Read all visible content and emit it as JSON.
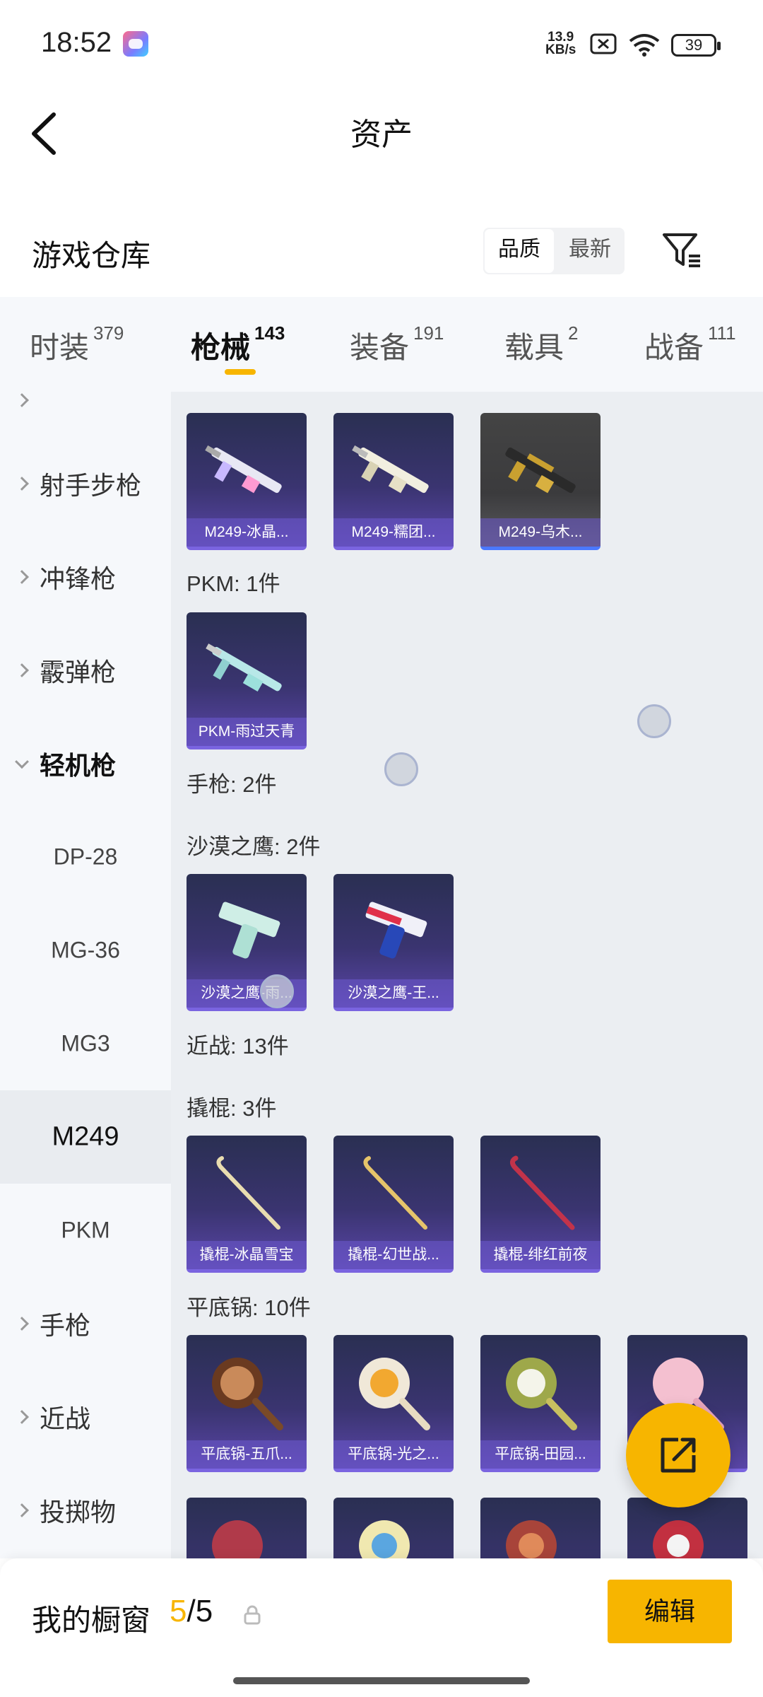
{
  "status_bar": {
    "time": "18:52",
    "net_speed_top": "13.9",
    "net_speed_unit": "KB/s",
    "battery": "39"
  },
  "header": {
    "title": "资产"
  },
  "warehouse": {
    "title": "游戏仓库",
    "sort_quality": "品质",
    "sort_newest": "最新"
  },
  "tabs": [
    {
      "label": "时装",
      "count": "379"
    },
    {
      "label": "枪械",
      "count": "143"
    },
    {
      "label": "装备",
      "count": "191"
    },
    {
      "label": "载具",
      "count": "2"
    },
    {
      "label": "战备",
      "count": "111"
    }
  ],
  "sidebar": {
    "items": [
      {
        "label": "射手步枪"
      },
      {
        "label": "冲锋枪"
      },
      {
        "label": "霰弹枪"
      },
      {
        "label": "轻机枪"
      },
      {
        "label": "DP-28"
      },
      {
        "label": "MG-36"
      },
      {
        "label": "MG3"
      },
      {
        "label": "M249"
      },
      {
        "label": "PKM"
      },
      {
        "label": "手枪"
      },
      {
        "label": "近战"
      },
      {
        "label": "投掷物"
      }
    ]
  },
  "content": {
    "m249_cards": [
      "M249-冰晶...",
      "M249-糯团...",
      "M249-乌木..."
    ],
    "pkm_section": "PKM: 1件",
    "pkm_cards": [
      "PKM-雨过天青"
    ],
    "pistol_section": "手枪: 2件",
    "deagle_section": "沙漠之鹰: 2件",
    "deagle_cards": [
      "沙漠之鹰-雨...",
      "沙漠之鹰-王..."
    ],
    "melee_section": "近战: 13件",
    "crowbar_section": "撬棍: 3件",
    "crowbar_cards": [
      "撬棍-冰晶雪宝",
      "撬棍-幻世战...",
      "撬棍-绯红前夜"
    ],
    "pan_section": "平底锅: 10件",
    "pan_cards": [
      "平底锅-五爪...",
      "平底锅-光之...",
      "平底锅-田园..."
    ]
  },
  "bottom": {
    "window_title": "我的橱窗",
    "window_current": "5",
    "window_total": "/5",
    "edit_label": "编辑"
  },
  "colors": {
    "accent": "#f7b500",
    "card_bg": "#3a3470",
    "sidebar_bg": "#f6f8fb",
    "content_bg": "#ebeef2"
  }
}
